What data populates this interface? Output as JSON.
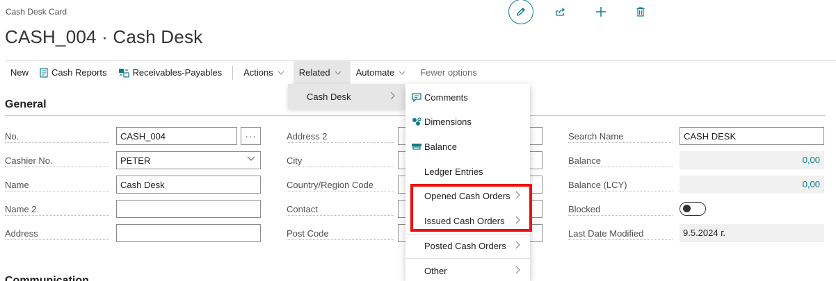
{
  "header": {
    "breadcrumb": "Cash Desk Card",
    "title": "CASH_004 · Cash Desk"
  },
  "top_actions": {
    "edit_icon": "pencil-icon",
    "share_icon": "share-icon",
    "new_icon": "plus-icon",
    "delete_icon": "trash-icon"
  },
  "actionbar": {
    "new": "New",
    "cash_reports": "Cash Reports",
    "receivables_payables": "Receivables-Payables",
    "actions": "Actions",
    "related": "Related",
    "automate": "Automate",
    "fewer_options": "Fewer options"
  },
  "section": {
    "general": "General",
    "communication": "Communication"
  },
  "fields": {
    "no": {
      "label": "No.",
      "value": "CASH_004"
    },
    "cashier_no": {
      "label": "Cashier No.",
      "value": "PETER"
    },
    "name": {
      "label": "Name",
      "value": "Cash Desk"
    },
    "name2": {
      "label": "Name 2",
      "value": ""
    },
    "address": {
      "label": "Address",
      "value": ""
    },
    "address2": {
      "label": "Address 2",
      "value": ""
    },
    "city": {
      "label": "City",
      "value": ""
    },
    "country": {
      "label": "Country/Region Code",
      "value": ""
    },
    "contact": {
      "label": "Contact",
      "value": ""
    },
    "post_code": {
      "label": "Post Code",
      "value": ""
    },
    "search_name": {
      "label": "Search Name",
      "value": "CASH DESK"
    },
    "balance": {
      "label": "Balance",
      "value": "0,00"
    },
    "balance_lcy": {
      "label": "Balance (LCY)",
      "value": "0,00"
    },
    "blocked": {
      "label": "Blocked",
      "value": false
    },
    "last_modified": {
      "label": "Last Date Modified",
      "value": "9.5.2024 г."
    }
  },
  "related_menu": {
    "submenu_label": "Cash Desk",
    "items": [
      {
        "label": "Comments",
        "icon": "comment-icon",
        "has_submenu": false
      },
      {
        "label": "Dimensions",
        "icon": "dimensions-icon",
        "has_submenu": false
      },
      {
        "label": "Balance",
        "icon": "balance-icon",
        "has_submenu": false
      },
      {
        "label": "Ledger Entries",
        "icon": "",
        "has_submenu": false
      },
      {
        "label": "Opened Cash Orders",
        "icon": "",
        "has_submenu": true
      },
      {
        "label": "Issued Cash Orders",
        "icon": "",
        "has_submenu": true
      },
      {
        "label": "Posted Cash Orders",
        "icon": "",
        "has_submenu": true
      },
      {
        "label": "Other",
        "icon": "",
        "has_submenu": true
      }
    ]
  },
  "colors": {
    "accent": "#0f7b8a",
    "highlight": "#ee1111"
  }
}
